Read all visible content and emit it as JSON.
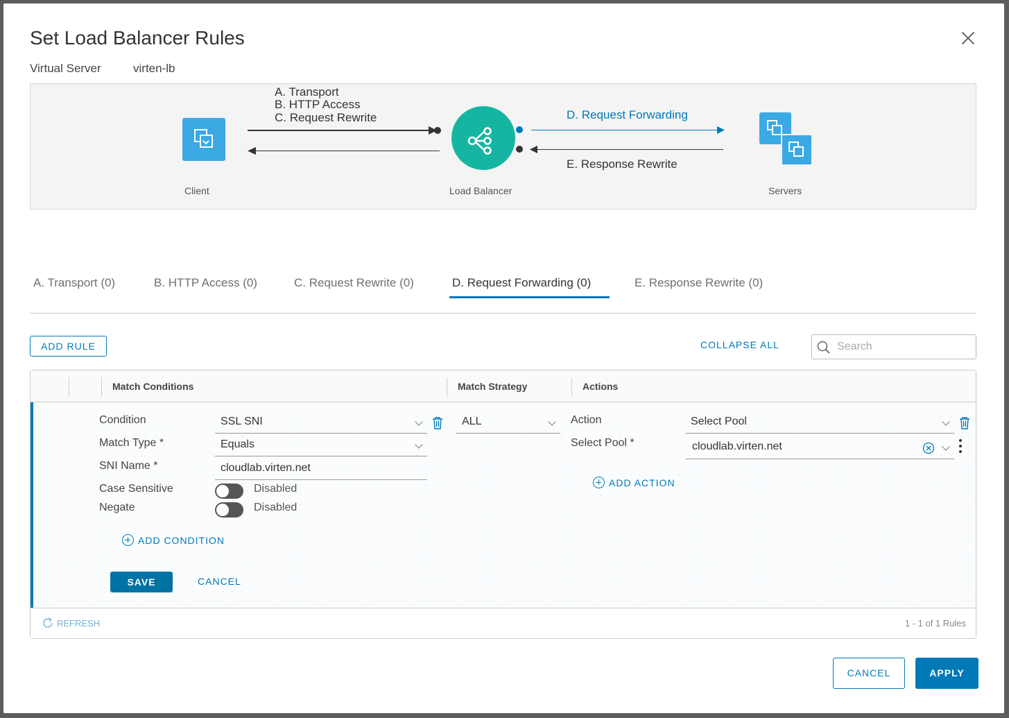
{
  "dialog": {
    "title": "Set Load Balancer Rules",
    "virtual_server_label": "Virtual Server",
    "virtual_server_value": "virten-lb"
  },
  "diagram": {
    "client_label": "Client",
    "lb_label": "Load Balancer",
    "servers_label": "Servers",
    "phase_a": "A. Transport",
    "phase_b": "B. HTTP Access",
    "phase_c": "C. Request Rewrite",
    "phase_d": "D. Request Forwarding",
    "phase_e": "E. Response Rewrite",
    "accent_color": "#0079b8",
    "lb_color": "#16b5a2",
    "icon_color": "#3aa9e4"
  },
  "tabs": [
    {
      "label": "A. Transport (0)",
      "active": false
    },
    {
      "label": "B. HTTP Access (0)",
      "active": false
    },
    {
      "label": "C. Request Rewrite (0)",
      "active": false
    },
    {
      "label": "D. Request Forwarding (0)",
      "active": true
    },
    {
      "label": "E. Response Rewrite (0)",
      "active": false
    }
  ],
  "toolbar": {
    "add_rule": "ADD RULE",
    "collapse_all": "COLLAPSE ALL",
    "search_placeholder": "Search"
  },
  "grid": {
    "headers": [
      "Match Conditions",
      "Match Strategy",
      "Actions"
    ],
    "rule": {
      "condition_label": "Condition",
      "condition_value": "SSL SNI",
      "match_type_label": "Match Type *",
      "match_type_value": "Equals",
      "sni_name_label": "SNI Name *",
      "sni_name_value": "cloudlab.virten.net",
      "case_sensitive_label": "Case Sensitive",
      "case_sensitive_value": "Disabled",
      "negate_label": "Negate",
      "negate_value": "Disabled",
      "add_condition": "ADD CONDITION",
      "match_strategy_value": "ALL",
      "action_label": "Action",
      "action_value": "Select Pool",
      "select_pool_label": "Select Pool *",
      "select_pool_value": "cloudlab.virten.net",
      "add_action": "ADD ACTION",
      "save": "SAVE",
      "cancel": "CANCEL"
    },
    "footer": {
      "refresh": "REFRESH",
      "pagination": "1 - 1 of 1 Rules"
    }
  },
  "footer": {
    "cancel": "CANCEL",
    "apply": "APPLY"
  }
}
